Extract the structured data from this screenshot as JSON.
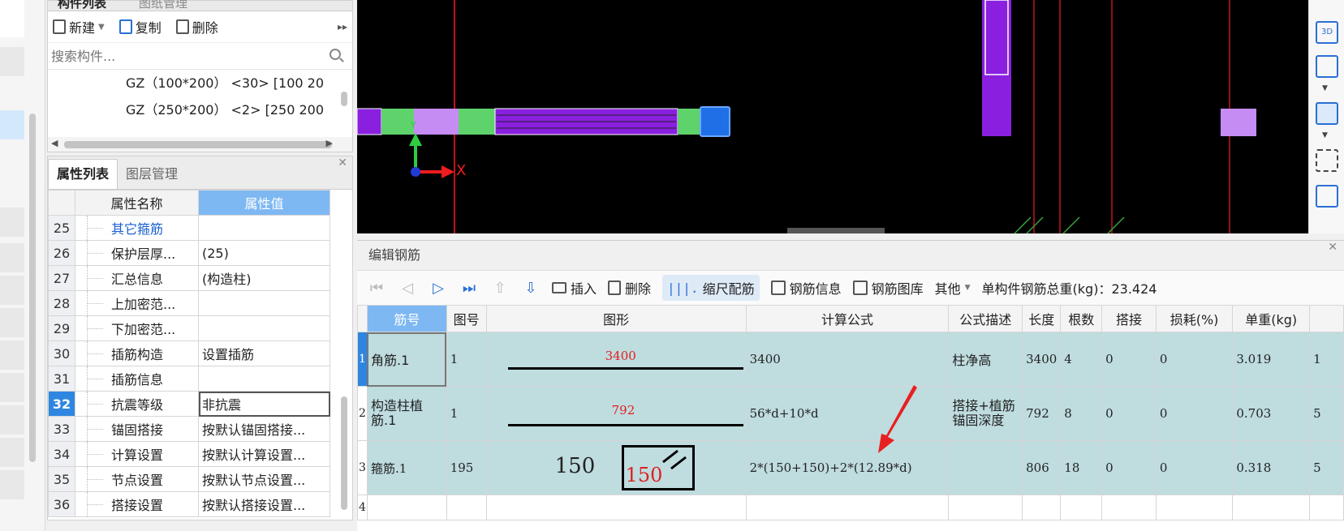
{
  "component_panel": {
    "tabs": [
      "构件列表",
      "图纸管理"
    ],
    "toolbar": {
      "new_label": "新建",
      "copy_label": "复制",
      "delete_label": "删除"
    },
    "search_placeholder": "搜索构件...",
    "items": [
      "GZ（100*200） <30> [100 20",
      "GZ（250*200） <2> [250 200"
    ]
  },
  "property_panel": {
    "tabs": [
      "属性列表",
      "图层管理"
    ],
    "headers": {
      "name": "属性名称",
      "value": "属性值"
    },
    "rows": [
      {
        "num": "25",
        "name": "其它箍筋",
        "value": ""
      },
      {
        "num": "26",
        "name": "保护层厚...",
        "value": "(25)"
      },
      {
        "num": "27",
        "name": "汇总信息",
        "value": "(构造柱)"
      },
      {
        "num": "28",
        "name": "上加密范...",
        "value": ""
      },
      {
        "num": "29",
        "name": "下加密范...",
        "value": ""
      },
      {
        "num": "30",
        "name": "插筋构造",
        "value": "设置插筋"
      },
      {
        "num": "31",
        "name": "插筋信息",
        "value": ""
      },
      {
        "num": "32",
        "name": "抗震等级",
        "value": "非抗震"
      },
      {
        "num": "33",
        "name": "锚固搭接",
        "value": "按默认锚固搭接..."
      },
      {
        "num": "34",
        "name": "计算设置",
        "value": "按默认计算设置..."
      },
      {
        "num": "35",
        "name": "节点设置",
        "value": "按默认节点设置..."
      },
      {
        "num": "36",
        "name": "搭接设置",
        "value": "按默认搭接设置..."
      }
    ]
  },
  "viewport": {
    "axis_x": "X",
    "axis_y": "Y",
    "colors": {
      "bg": "#000000",
      "purple": "#8a1fe0",
      "green": "#5fd36b",
      "lavender": "#c58cf4",
      "blue": "#1f6fe6",
      "red_line": "#c0151a"
    }
  },
  "right_toolbar": {
    "view3d_label": "3D"
  },
  "rebar_panel": {
    "title": "编辑钢筋",
    "toolbar": {
      "insert_label": "插入",
      "delete_label": "删除",
      "scale_label": "缩尺配筋",
      "info_label": "钢筋信息",
      "library_label": "钢筋图库",
      "other_label": "其他",
      "total_label": "单构件钢筋总重(kg)：23.424"
    },
    "headers": [
      "筋号",
      "图号",
      "图形",
      "计算公式",
      "公式描述",
      "长度",
      "根数",
      "搭接",
      "损耗(%)",
      "单重(kg)"
    ],
    "rows": [
      {
        "index": "1",
        "name": "角筋.1",
        "fig": "1",
        "shape_len": "3400",
        "formula": "3400",
        "desc": "柱净高",
        "length": "3400",
        "count": "4",
        "lap": "0",
        "loss": "0",
        "weight": "3.019",
        "extra": "1"
      },
      {
        "index": "2",
        "name": "构造柱植筋.1",
        "fig": "1",
        "shape_len": "792",
        "formula": "56*d+10*d",
        "desc": "搭接+植筋锚固深度",
        "length": "792",
        "count": "8",
        "lap": "0",
        "loss": "0",
        "weight": "0.703",
        "extra": "5"
      },
      {
        "index": "3",
        "name": "箍筋.1",
        "fig": "195",
        "shape_a": "150",
        "shape_b": "150",
        "formula": "2*(150+150)+2*(12.89*d)",
        "desc": "",
        "length": "806",
        "count": "18",
        "lap": "0",
        "loss": "0",
        "weight": "0.318",
        "extra": "5"
      },
      {
        "index": "4"
      }
    ]
  }
}
